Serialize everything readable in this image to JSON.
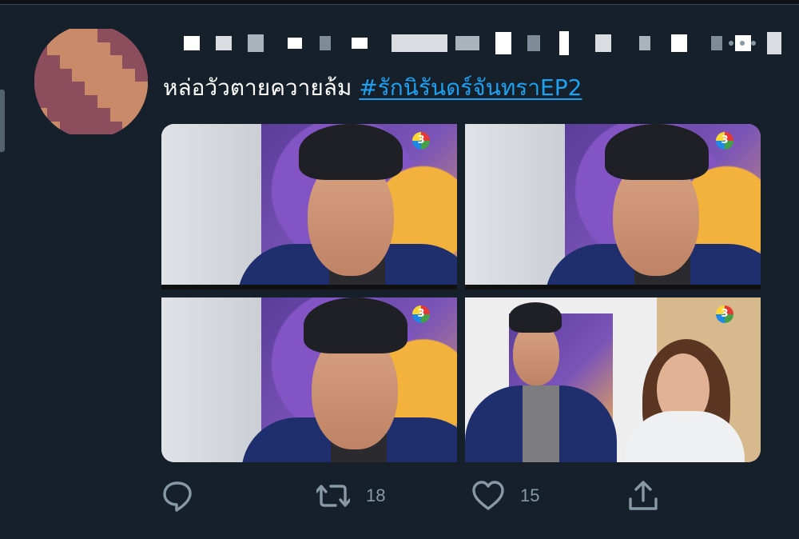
{
  "tweet": {
    "text": "หล่อวัวตายควายล้ม ",
    "hashtag": "#รักนิรันดร์จันทราEP2"
  },
  "actions": {
    "reply_count": "",
    "retweet_count": "18",
    "like_count": "15"
  },
  "colors": {
    "background": "#15202b",
    "accent": "#1da1f2",
    "muted": "#8899a6"
  },
  "icons": [
    "more-icon",
    "reply-icon",
    "retweet-icon",
    "like-icon",
    "share-icon"
  ]
}
